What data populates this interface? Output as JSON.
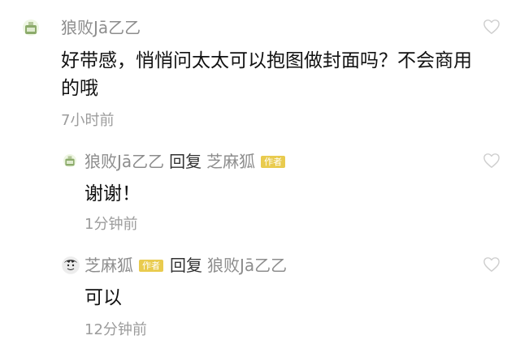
{
  "comments": [
    {
      "author": "狼败Jā乙乙",
      "text": "好带感，悄悄问太太可以抱图做封面吗？不会商用的哦",
      "time": "7小时前",
      "avatar_icon": "bottle-avatar-icon",
      "like_icon": "heart-outline-icon"
    },
    {
      "author": "狼败Jā乙乙",
      "reply_word": "回复",
      "reply_to": "芝麻狐",
      "reply_to_badge": "作者",
      "text": "谢谢！",
      "time": "1分钟前",
      "avatar_icon": "bottle-avatar-icon",
      "like_icon": "heart-outline-icon"
    },
    {
      "author": "芝麻狐",
      "author_badge": "作者",
      "reply_word": "回复",
      "reply_to": "狼败Jā乙乙",
      "text": "可以",
      "time": "12分钟前",
      "avatar_icon": "sketch-face-avatar-icon",
      "like_icon": "heart-outline-icon"
    }
  ],
  "colors": {
    "name": "#8d8d8d",
    "badge_bg": "#e9cb4e",
    "text": "#111111",
    "time": "#9c9c9c",
    "heart_outline": "#cfcfcf"
  }
}
